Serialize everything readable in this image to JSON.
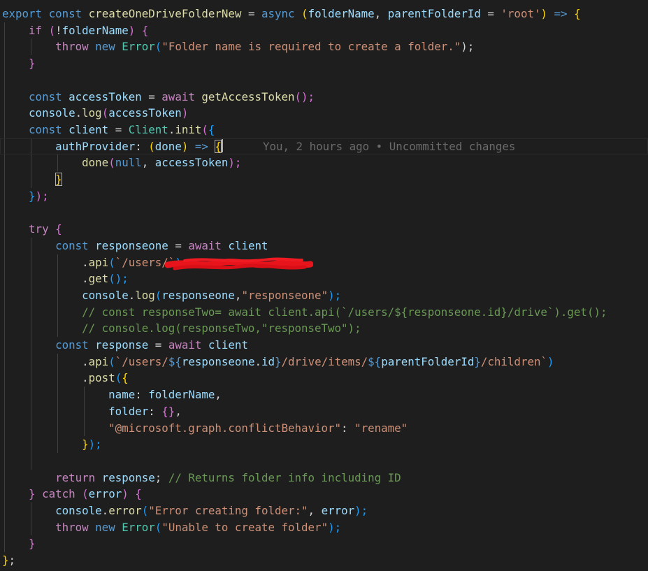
{
  "editor": {
    "blame_annotation": "You, 2 hours ago • Uncommitted changes",
    "lines": [
      [
        "export",
        " ",
        "const",
        " ",
        "createOneDriveFolderNew",
        " ",
        "=",
        " ",
        "async",
        " ",
        "(",
        "folderName",
        ", ",
        "parentFolderId",
        " = ",
        "'root'",
        ")",
        " ",
        "=>",
        " ",
        "{"
      ],
      [
        "if",
        " ",
        "(",
        "!",
        "folderName",
        ")",
        " ",
        "{"
      ],
      [
        "throw",
        " ",
        "new",
        " ",
        "Error",
        "(",
        "\"Folder name is required to create a folder.\"",
        ");"
      ],
      [
        "}"
      ],
      [],
      [
        "const",
        " ",
        "accessToken",
        " ",
        "=",
        " ",
        "await",
        " ",
        "getAccessToken",
        "();"
      ],
      [
        "console",
        ".",
        "log",
        "(",
        "accessToken",
        ")"
      ],
      [
        "const",
        " ",
        "client",
        " ",
        "=",
        " ",
        "Client",
        ".",
        "init",
        "(",
        "{"
      ],
      [
        "authProvider",
        ":",
        " ",
        "(",
        "done",
        ")",
        " ",
        "=>",
        " ",
        "{"
      ],
      [
        "done",
        "(",
        "null",
        ", ",
        "accessToken",
        ");"
      ],
      [
        "}"
      ],
      [
        "}",
        ");"
      ],
      [],
      [
        "try",
        " ",
        "{"
      ],
      [
        "const",
        " ",
        "responseone",
        " ",
        "=",
        " ",
        "await",
        " ",
        "client"
      ],
      [
        ".",
        "api",
        "(",
        "`/users/",
        "",
        "`",
        ")"
      ],
      [
        ".",
        "get",
        "();"
      ],
      [
        "console",
        ".",
        "log",
        "(",
        "responseone",
        ",",
        "\"responseone\"",
        ");"
      ],
      [
        "// const responseTwo= await client.api(`/users/${responseone.id}/drive`).get();"
      ],
      [
        "// console.log(responseTwo,\"responseTwo\");"
      ],
      [
        "const",
        " ",
        "response",
        " ",
        "=",
        " ",
        "await",
        " ",
        "client"
      ],
      [
        ".",
        "api",
        "(",
        "`/users/",
        "${",
        "responseone",
        ".",
        "id",
        "}",
        "/drive/items/",
        "${",
        "parentFolderId",
        "}",
        "/children`",
        ")"
      ],
      [
        ".",
        "post",
        "(",
        "{"
      ],
      [
        "name",
        ":",
        " ",
        "folderName",
        ","
      ],
      [
        "folder",
        ":",
        " ",
        "{}",
        ","
      ],
      [
        "\"@microsoft.graph.conflictBehavior\"",
        ":",
        " ",
        "\"rename\""
      ],
      [
        "}",
        ");"
      ],
      [],
      [
        "return",
        " ",
        "response",
        ";",
        " ",
        "// Returns folder info including ID"
      ],
      [
        "}",
        " ",
        "catch",
        " ",
        "(",
        "error",
        ")",
        " ",
        "{"
      ],
      [
        "console",
        ".",
        "error",
        "(",
        "\"Error creating folder:\"",
        ", ",
        "error",
        ");"
      ],
      [
        "throw",
        " ",
        "new",
        " ",
        "Error",
        "(",
        "\"Unable to create folder\"",
        ");"
      ],
      [
        "}"
      ],
      [
        "}",
        ";"
      ]
    ]
  }
}
